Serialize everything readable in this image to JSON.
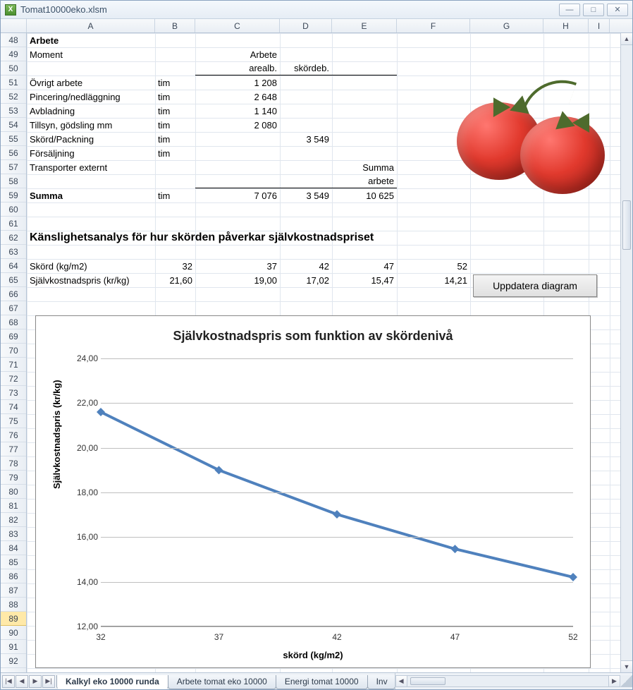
{
  "window": {
    "title": "Tomat10000eko.xlsm"
  },
  "columns": [
    "A",
    "B",
    "C",
    "D",
    "E",
    "F",
    "G",
    "H",
    "I"
  ],
  "rowStart": 48,
  "rowEnd": 92,
  "selectedRow": 89,
  "section1": {
    "header": "Arbete",
    "subheader": "Moment",
    "colhead_C": "Arbete",
    "colhead_C2": "arealb.",
    "colhead_D": "skördeb.",
    "rows": [
      {
        "label": "Övrigt arbete",
        "unit": "tim",
        "c": "1 208",
        "d": ""
      },
      {
        "label": "Pincering/nedläggning",
        "unit": "tim",
        "c": "2 648",
        "d": ""
      },
      {
        "label": "Avbladning",
        "unit": "tim",
        "c": "1 140",
        "d": ""
      },
      {
        "label": "Tillsyn, gödsling mm",
        "unit": "tim",
        "c": "2 080",
        "d": ""
      },
      {
        "label": "Skörd/Packning",
        "unit": "tim",
        "c": "",
        "d": "3 549"
      },
      {
        "label": "Försäljning",
        "unit": "tim",
        "c": "",
        "d": ""
      },
      {
        "label": "Transporter externt",
        "unit": "",
        "c": "",
        "d": ""
      }
    ],
    "sum_label_E1": "Summa",
    "sum_label_E2": "arbete",
    "total": {
      "label": "Summa",
      "unit": "tim",
      "c": "7 076",
      "d": "3 549",
      "e": "10 625"
    }
  },
  "section2": {
    "title": "Känslighetsanalys för hur skörden påverkar självkostnadspriset",
    "row1_label": "Skörd (kg/m2)",
    "row2_label": "Självkostnadspris (kr/kg)",
    "row1": [
      "32",
      "37",
      "42",
      "47",
      "52"
    ],
    "row2": [
      "21,60",
      "19,00",
      "17,02",
      "15,47",
      "14,21"
    ],
    "button": "Uppdatera diagram"
  },
  "chart_data": {
    "type": "line",
    "title": "Självkostnadspris som funktion av skördenivå",
    "xlabel": "skörd (kg/m2)",
    "ylabel": "Självkostnadspris (kr/kg)",
    "x": [
      32,
      37,
      42,
      47,
      52
    ],
    "y": [
      21.6,
      19.0,
      17.02,
      15.47,
      14.21
    ],
    "xlim": [
      32,
      52
    ],
    "ylim": [
      12,
      24
    ],
    "yticks": [
      12.0,
      14.0,
      16.0,
      18.0,
      20.0,
      22.0,
      24.0
    ],
    "xticks": [
      32,
      37,
      42,
      47,
      52
    ]
  },
  "sheets": {
    "active": "Kalkyl eko 10000 runda",
    "others": [
      "Arbete tomat eko 10000",
      "Energi tomat 10000",
      "Inv"
    ]
  }
}
